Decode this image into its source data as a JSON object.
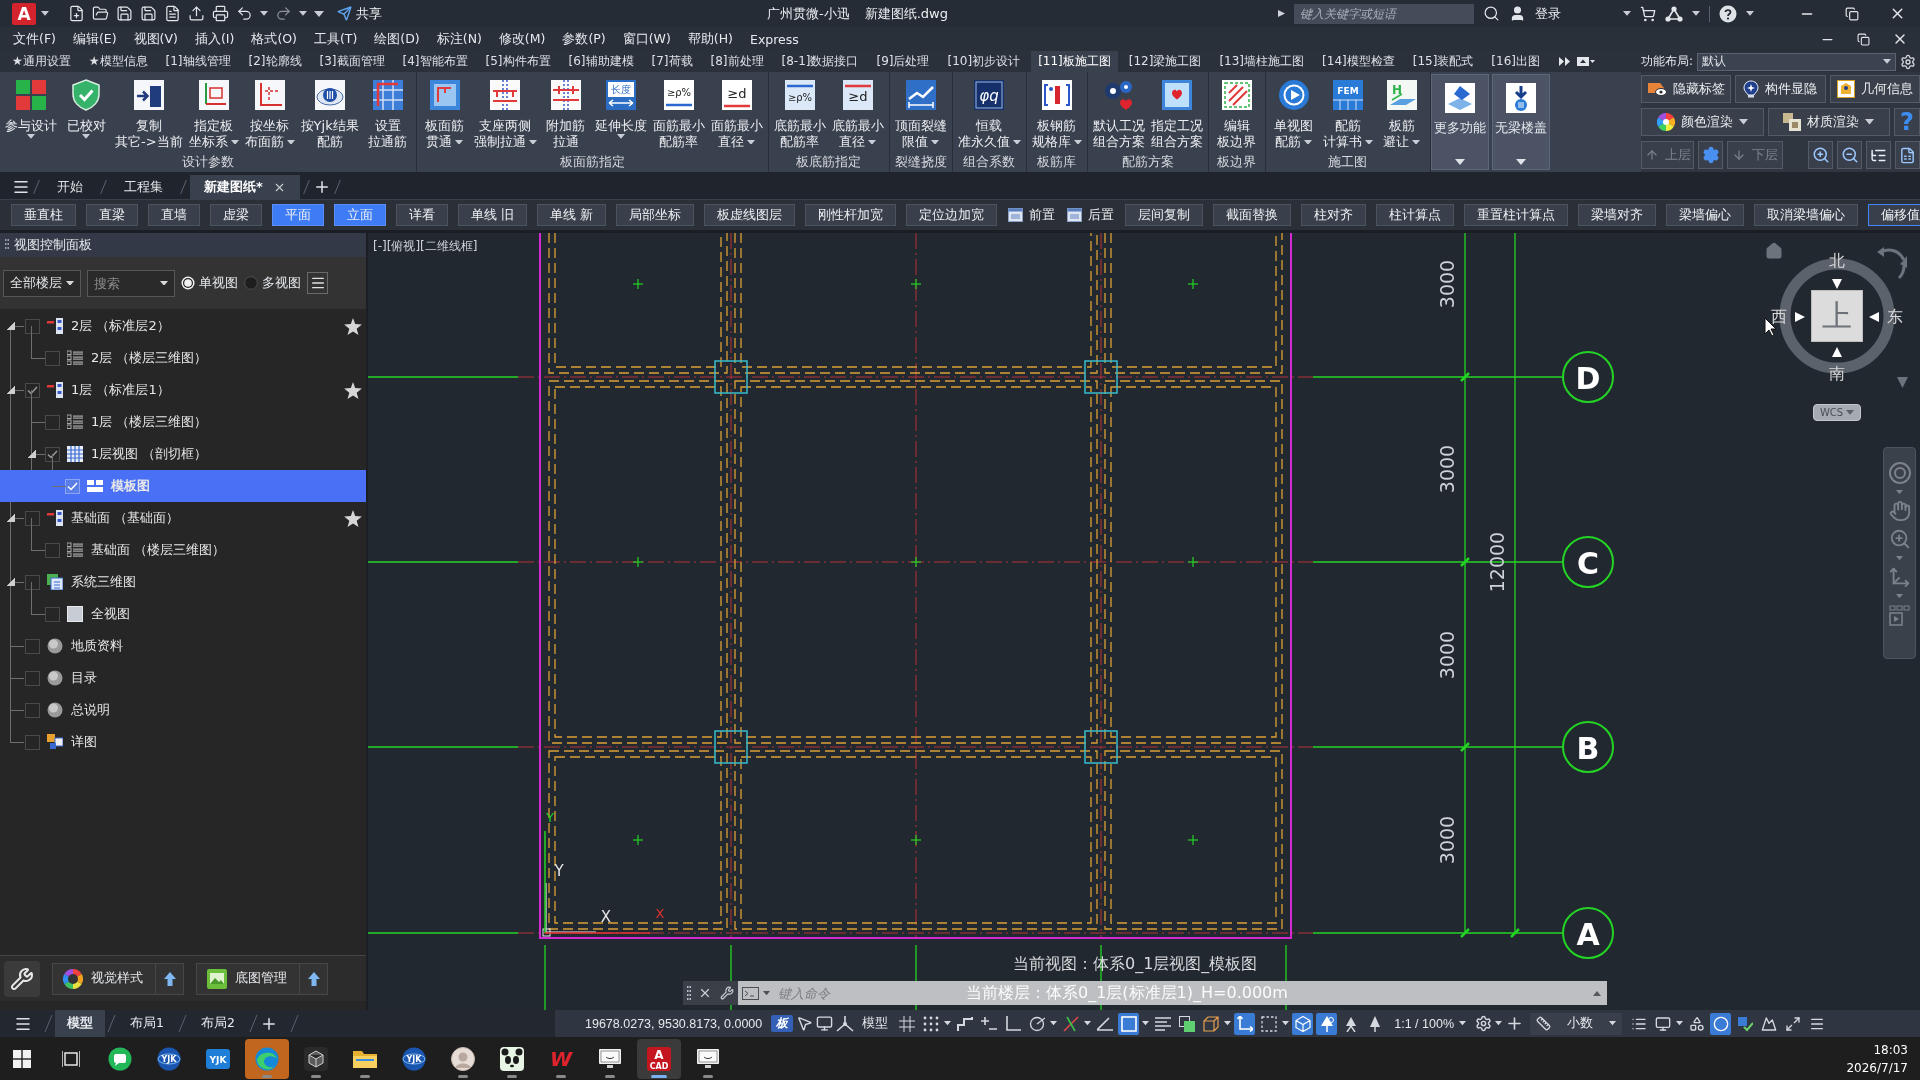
{
  "title_bar": {
    "logo": "A",
    "share": "共享",
    "app_name": "广州贯微-小迅",
    "file_name": "新建图纸.dwg",
    "search": {
      "placeholder": "键入关键字或短语"
    },
    "login": "登录"
  },
  "menu_bar": [
    "文件(F)",
    "编辑(E)",
    "视图(V)",
    "插入(I)",
    "格式(O)",
    "工具(T)",
    "绘图(D)",
    "标注(N)",
    "修改(M)",
    "参数(P)",
    "窗口(W)",
    "帮助(H)",
    "Express"
  ],
  "ribbon": {
    "tabs": [
      {
        "label": "★通用设置",
        "selected": false
      },
      {
        "label": "★模型信息",
        "selected": false
      },
      {
        "label": "[1]轴线管理",
        "selected": false
      },
      {
        "label": "[2]轮廓线",
        "selected": false
      },
      {
        "label": "[3]截面管理",
        "selected": false
      },
      {
        "label": "[4]智能布置",
        "selected": false
      },
      {
        "label": "[5]构件布置",
        "selected": false
      },
      {
        "label": "[6]辅助建模",
        "selected": false
      },
      {
        "label": "[7]荷载",
        "selected": false
      },
      {
        "label": "[8]前处理",
        "selected": false
      },
      {
        "label": "[8-1]数据接口",
        "selected": false
      },
      {
        "label": "[9]后处理",
        "selected": false
      },
      {
        "label": "[10]初步设计",
        "selected": false
      },
      {
        "label": "[11]板施工图",
        "selected": true
      },
      {
        "label": "[12]梁施工图",
        "selected": false
      },
      {
        "label": "[13]墙柱施工图",
        "selected": false
      },
      {
        "label": "[14]模型检查",
        "selected": false
      },
      {
        "label": "[15]装配式",
        "selected": false
      },
      {
        "label": "[16]出图",
        "selected": false
      }
    ],
    "groups": [
      {
        "title": "设计参数",
        "buttons": [
          {
            "lines": [
              "参与设计"
            ],
            "dropdown": true
          },
          {
            "lines": [
              "已校对"
            ],
            "dropdown": true
          },
          {
            "lines": [
              "复制",
              "其它->当前"
            ],
            "dropdown": false
          },
          {
            "lines": [
              "指定板",
              "坐标系"
            ],
            "dropdown": true
          },
          {
            "lines": [
              "按坐标",
              "布面筋"
            ],
            "dropdown": true
          },
          {
            "lines": [
              "按Yjk结果",
              "配筋"
            ],
            "dropdown": false
          },
          {
            "lines": [
              "设置",
              "拉通筋"
            ],
            "dropdown": false
          }
        ]
      },
      {
        "title": "板面筋指定",
        "buttons": [
          {
            "lines": [
              "板面筋",
              "贯通"
            ],
            "dropdown": true
          },
          {
            "lines": [
              "支座两侧",
              "强制拉通"
            ],
            "dropdown": true
          },
          {
            "lines": [
              "附加筋",
              "拉通"
            ],
            "dropdown": false
          },
          {
            "lines": [
              "延伸长度"
            ],
            "dropdown": true,
            "glyph": "长度"
          },
          {
            "lines": [
              "面筋最小",
              "配筋率"
            ],
            "dropdown": false,
            "glyph": "≥ρ%"
          },
          {
            "lines": [
              "面筋最小",
              "直径"
            ],
            "dropdown": true,
            "glyph": "≥d"
          }
        ]
      },
      {
        "title": "板底筋指定",
        "buttons": [
          {
            "lines": [
              "底筋最小",
              "配筋率"
            ],
            "dropdown": false,
            "glyph": "≥ρ%"
          },
          {
            "lines": [
              "底筋最小",
              "直径"
            ],
            "dropdown": true,
            "glyph": "≥d"
          }
        ]
      },
      {
        "title": "裂缝挠度",
        "buttons": [
          {
            "lines": [
              "顶面裂缝",
              "限值"
            ],
            "dropdown": true
          }
        ]
      },
      {
        "title": "组合系数",
        "buttons": [
          {
            "lines": [
              "恒载",
              "准永久值"
            ],
            "dropdown": true,
            "glyph": "φq"
          }
        ]
      },
      {
        "title": "板筋库",
        "buttons": [
          {
            "lines": [
              "板钢筋",
              "规格库"
            ],
            "dropdown": true
          }
        ]
      },
      {
        "title": "配筋方案",
        "buttons": [
          {
            "lines": [
              "默认工况",
              "组合方案"
            ],
            "dropdown": false
          },
          {
            "lines": [
              "指定工况",
              "组合方案"
            ],
            "dropdown": false
          }
        ]
      },
      {
        "title": "板边界",
        "buttons": [
          {
            "lines": [
              "编辑",
              "板边界"
            ],
            "dropdown": false
          }
        ]
      },
      {
        "title": "施工图",
        "buttons": [
          {
            "lines": [
              "单视图",
              "配筋"
            ],
            "dropdown": true
          },
          {
            "lines": [
              "配筋",
              "计算书"
            ],
            "dropdown": true,
            "glyph": "FEM"
          },
          {
            "lines": [
              "板筋",
              "避让"
            ],
            "dropdown": true,
            "glyph": "H"
          }
        ]
      }
    ],
    "panels": [
      {
        "label": "更多功能",
        "dropdown": true
      },
      {
        "label": "无梁楼盖",
        "dropdown": true
      }
    ]
  },
  "side_tools": {
    "layout_label": "功能布局:",
    "layout_value": "默认",
    "buttons": [
      {
        "label": "隐藏标签"
      },
      {
        "label": "构件显隐"
      },
      {
        "label": "几何信息"
      }
    ],
    "renders": [
      {
        "label": "颜色渲染"
      },
      {
        "label": "材质渲染"
      }
    ],
    "help": "?",
    "floors": [
      {
        "label": "上层",
        "disabled": true
      },
      {
        "label": "下层",
        "disabled": true
      }
    ]
  },
  "doc_tabs": [
    {
      "label": "开始",
      "selected": false
    },
    {
      "label": "工程集",
      "selected": false
    },
    {
      "label": "新建图纸*",
      "selected": true
    }
  ],
  "toolbar": [
    {
      "kind": "button",
      "label": "垂直柱",
      "on": false,
      "focused": false
    },
    {
      "kind": "button",
      "label": "直梁",
      "on": false,
      "focused": false
    },
    {
      "kind": "button",
      "label": "直墙",
      "on": false,
      "focused": false
    },
    {
      "kind": "button",
      "label": "虚梁",
      "on": false,
      "focused": false
    },
    {
      "kind": "button",
      "label": "平面",
      "on": true,
      "focused": false
    },
    {
      "kind": "button",
      "label": "立面",
      "on": true,
      "focused": false
    },
    {
      "kind": "button",
      "label": "详看",
      "on": false,
      "focused": false
    },
    {
      "kind": "button",
      "label": "单线 旧",
      "on": false,
      "focused": false
    },
    {
      "kind": "button",
      "label": "单线 新",
      "on": false,
      "focused": false
    },
    {
      "kind": "button",
      "label": "局部坐标",
      "on": false,
      "focused": false
    },
    {
      "kind": "button",
      "label": "板虚线图层",
      "on": false,
      "focused": false
    },
    {
      "kind": "button",
      "label": "刚性杆加宽",
      "on": false,
      "focused": false
    },
    {
      "kind": "button",
      "label": "定位边加宽",
      "on": false,
      "focused": false
    },
    {
      "kind": "icon",
      "label": "前置",
      "on": false,
      "focused": false
    },
    {
      "kind": "icon",
      "label": "后置",
      "on": false,
      "focused": false
    },
    {
      "kind": "button",
      "label": "层间复制",
      "on": false,
      "focused": false
    },
    {
      "kind": "button",
      "label": "截面替换",
      "on": false,
      "focused": false
    },
    {
      "kind": "button",
      "label": "柱对齐",
      "on": false,
      "focused": false
    },
    {
      "kind": "button",
      "label": "柱计算点",
      "on": false,
      "focused": false
    },
    {
      "kind": "button",
      "label": "重置柱计算点",
      "on": false,
      "focused": false
    },
    {
      "kind": "button",
      "label": "梁墙对齐",
      "on": false,
      "focused": false
    },
    {
      "kind": "button",
      "label": "梁墙偏心",
      "on": false,
      "focused": false
    },
    {
      "kind": "button",
      "label": "取消梁墙偏心",
      "on": false,
      "focused": false
    },
    {
      "kind": "button",
      "label": "偏移值",
      "on": false,
      "focused": true
    }
  ],
  "panel": {
    "title": "视图控制面板",
    "floor_filter": "全部楼层",
    "search": {
      "placeholder": "搜索"
    },
    "view_modes": [
      {
        "label": "单视图",
        "selected": true
      },
      {
        "label": "多视图",
        "selected": false
      }
    ],
    "tree": [
      {
        "label": "2层 （标准层2）",
        "kind": "floor",
        "checked": false,
        "starred": true,
        "selected": false,
        "expanded": true,
        "children": [
          {
            "label": "2层 （楼层三维图）",
            "kind": "floor-3d",
            "checked": false,
            "starred": false,
            "selected": false
          }
        ]
      },
      {
        "label": "1层 （标准层1）",
        "kind": "floor",
        "checked": true,
        "starred": true,
        "selected": false,
        "expanded": true,
        "children": [
          {
            "label": "1层 （楼层三维图）",
            "kind": "floor-3d",
            "checked": false,
            "starred": false,
            "selected": false
          },
          {
            "label": "1层视图 （剖切框）",
            "kind": "section-view",
            "checked": true,
            "starred": false,
            "selected": false,
            "expanded": true,
            "children": [
              {
                "label": "模板图",
                "kind": "plan",
                "checked": true,
                "starred": false,
                "selected": true
              }
            ]
          }
        ]
      },
      {
        "label": "基础面 （基础面）",
        "kind": "floor",
        "checked": false,
        "starred": true,
        "selected": false,
        "expanded": true,
        "children": [
          {
            "label": "基础面 （楼层三维图）",
            "kind": "floor-3d",
            "checked": false,
            "starred": false,
            "selected": false
          }
        ]
      },
      {
        "label": "系统三维图",
        "kind": "system-3d",
        "checked": false,
        "starred": false,
        "selected": false,
        "expanded": true,
        "children": [
          {
            "label": "全视图",
            "kind": "full-view",
            "checked": false,
            "starred": false,
            "selected": false
          }
        ]
      },
      {
        "label": "地质资料",
        "kind": "sphere",
        "checked": false,
        "starred": false,
        "selected": false
      },
      {
        "label": "目录",
        "kind": "sphere",
        "checked": false,
        "starred": false,
        "selected": false
      },
      {
        "label": "总说明",
        "kind": "sphere",
        "checked": false,
        "starred": false,
        "selected": false
      },
      {
        "label": "详图",
        "kind": "detail",
        "checked": false,
        "starred": false,
        "selected": false
      }
    ],
    "footer": [
      {
        "label": "视觉样式"
      },
      {
        "label": "底图管理"
      }
    ]
  },
  "canvas": {
    "viewport_label": "[-][俯视][二维线框]",
    "axes": [
      {
        "label": "D"
      },
      {
        "label": "C"
      },
      {
        "label": "B"
      },
      {
        "label": "A"
      }
    ],
    "spans": [
      "3000",
      "3000",
      "3000",
      "3000"
    ],
    "total": "12000",
    "ucs": [
      {
        "kind": "view",
        "x_label": "X",
        "y_label": "Y"
      },
      {
        "kind": "model",
        "x_label": "X",
        "y_label": "Y"
      }
    ],
    "view_cube": {
      "north": "北",
      "south": "南",
      "west": "西",
      "east": "东",
      "face": "上",
      "coordinate_system": "WCS"
    },
    "command": {
      "history": [
        "当前视图：体系0_1层视图_模板图",
        "当前楼层：体系0_1层(标准层1)_H=0.000m"
      ],
      "placeholder": "键入命令"
    }
  },
  "layout_tabs": [
    {
      "label": "模型",
      "selected": true
    },
    {
      "label": "布局1",
      "selected": false
    },
    {
      "label": "布局2",
      "selected": false
    }
  ],
  "status_bar": {
    "coordinates": "19678.0273, 9530.8173, 0.0000",
    "tag": "板",
    "space": "模型",
    "scale": "1:1 / 100%",
    "units": "小数",
    "tools": [
      {
        "on": false,
        "dropdown": false
      },
      {
        "on": false,
        "dropdown": true
      },
      {
        "on": false,
        "dropdown": false
      },
      {
        "on": false,
        "dropdown": false
      },
      {
        "on": false,
        "dropdown": false
      },
      {
        "on": false,
        "dropdown": true
      },
      {
        "on": false,
        "dropdown": true
      },
      {
        "on": false,
        "dropdown": false
      },
      {
        "on": true,
        "dropdown": true
      },
      {
        "on": false,
        "dropdown": false
      },
      {
        "on": false,
        "dropdown": false
      },
      {
        "on": false,
        "dropdown": true
      },
      {
        "on": true,
        "dropdown": false
      },
      {
        "on": false,
        "dropdown": true
      },
      {
        "on": true,
        "dropdown": false
      },
      {
        "on": true,
        "dropdown": false
      },
      {
        "on": false,
        "dropdown": false
      },
      {
        "on": false,
        "dropdown": false
      }
    ],
    "end_tools": [
      {
        "on": false,
        "dropdown": false
      },
      {
        "on": false,
        "dropdown": true
      },
      {
        "on": false,
        "dropdown": false
      },
      {
        "on": true,
        "dropdown": false
      },
      {
        "on": false,
        "dropdown": false
      },
      {
        "on": false,
        "dropdown": false
      },
      {
        "on": false,
        "dropdown": false
      },
      {
        "on": false,
        "dropdown": false
      }
    ]
  },
  "taskbar": {
    "apps": [
      {
        "selected": false,
        "flashing": false,
        "running": false
      },
      {
        "selected": false,
        "flashing": false,
        "running": false,
        "glyph": "YJK"
      },
      {
        "selected": false,
        "flashing": false,
        "running": false,
        "glyph": "YJK"
      },
      {
        "selected": false,
        "flashing": true,
        "running": true
      },
      {
        "selected": false,
        "flashing": false,
        "running": true
      },
      {
        "selected": false,
        "flashing": false,
        "running": true
      },
      {
        "selected": false,
        "flashing": false,
        "running": false,
        "glyph": "YJK"
      },
      {
        "selected": false,
        "flashing": false,
        "running": true
      },
      {
        "selected": false,
        "flashing": false,
        "running": true
      },
      {
        "selected": false,
        "flashing": false,
        "running": true,
        "glyph": "W"
      },
      {
        "selected": false,
        "flashing": false,
        "running": true
      },
      {
        "selected": true,
        "flashing": false,
        "running": true,
        "glyph": "A",
        "sub": "CAD"
      },
      {
        "selected": false,
        "flashing": false,
        "running": true
      }
    ],
    "time": "18:03",
    "date": "2026/7/17"
  }
}
